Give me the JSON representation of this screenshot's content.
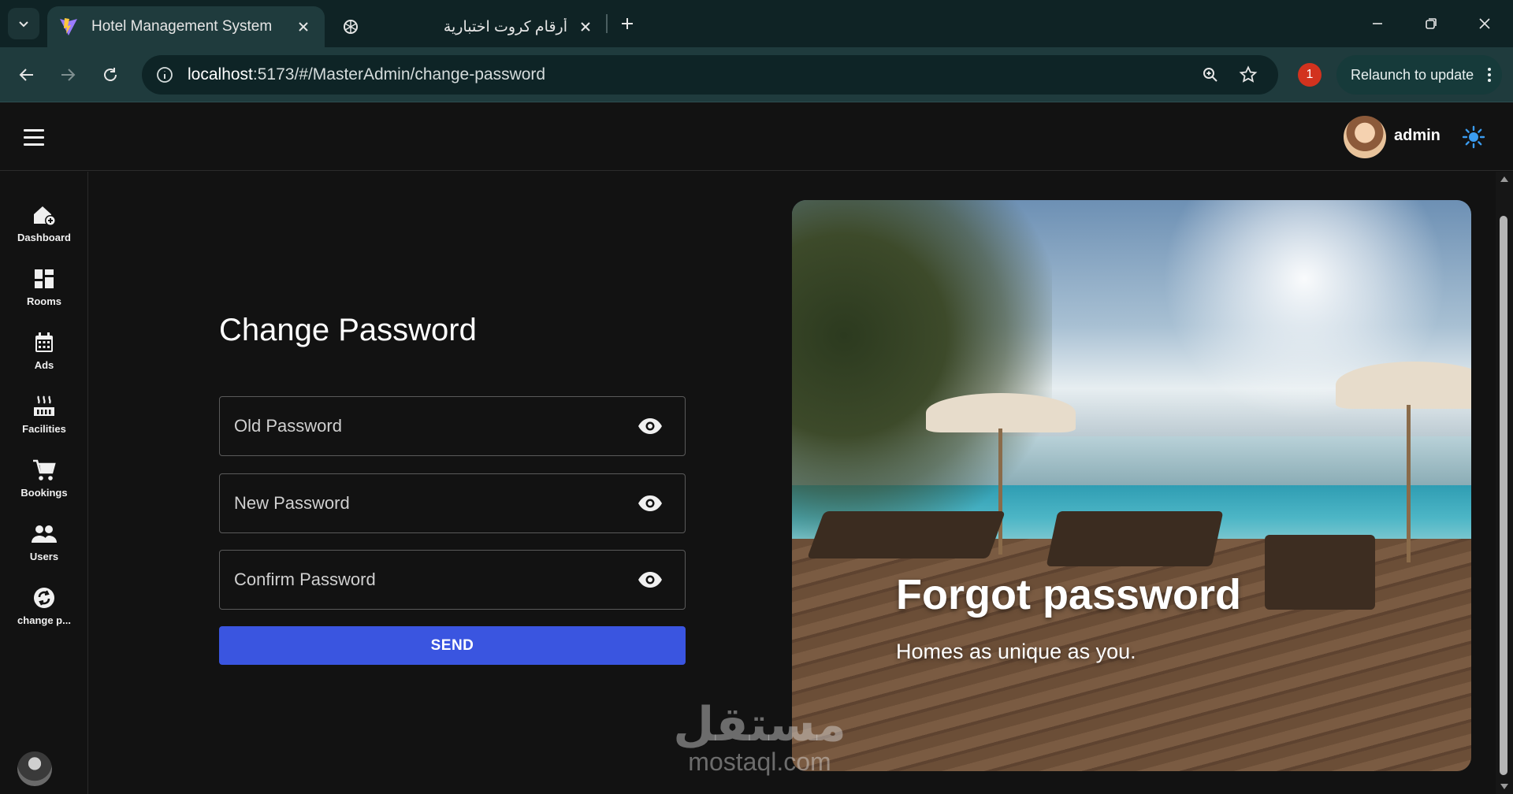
{
  "browser": {
    "tabs": [
      {
        "title": "Hotel Management System",
        "active": true
      },
      {
        "title": "أرقام كروت اختبارية",
        "active": false
      }
    ],
    "url_host": "localhost",
    "url_rest": ":5173/#/MasterAdmin/change-password",
    "extension_badge": "1",
    "relaunch_label": "Relaunch to update"
  },
  "header": {
    "username": "admin"
  },
  "sidebar": {
    "items": [
      {
        "label": "Dashboard",
        "icon": "home-add-icon"
      },
      {
        "label": "Rooms",
        "icon": "dashboard-grid-icon"
      },
      {
        "label": "Ads",
        "icon": "calendar-icon"
      },
      {
        "label": "Facilities",
        "icon": "hot-tub-icon"
      },
      {
        "label": "Bookings",
        "icon": "shopping-cart-icon"
      },
      {
        "label": "Users",
        "icon": "people-icon"
      },
      {
        "label": "change p...",
        "icon": "sync-lock-icon"
      }
    ]
  },
  "form": {
    "title": "Change Password",
    "fields": [
      {
        "label": "Old Password"
      },
      {
        "label": "New Password"
      },
      {
        "label": "Confirm Password"
      }
    ],
    "submit_label": "SEND"
  },
  "hero": {
    "title": "Forgot password",
    "subtitle": "Homes as unique as you."
  },
  "watermark": {
    "arabic": "مستقل",
    "latin": "mostaql.com"
  },
  "colors": {
    "accent": "#3a55e0",
    "background": "#121212",
    "chrome": "#1f3b3d"
  }
}
